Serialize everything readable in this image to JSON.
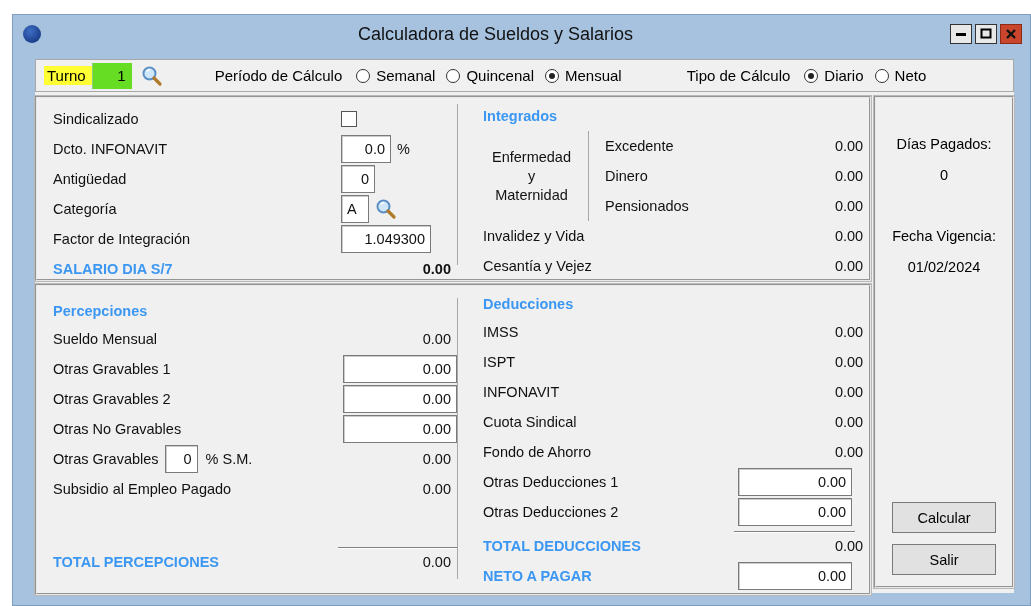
{
  "window": {
    "title": "Calculadora de Sueldos y Salarios"
  },
  "toolbar": {
    "turno": {
      "label": "Turno",
      "value": "1"
    },
    "periodo": {
      "label": "Período de Cálculo",
      "options": [
        {
          "label": "Semanal",
          "selected": false
        },
        {
          "label": "Quincenal",
          "selected": false
        },
        {
          "label": "Mensual",
          "selected": true
        }
      ]
    },
    "tipo": {
      "label": "Tipo de Cálculo",
      "options": [
        {
          "label": "Diario",
          "selected": true
        },
        {
          "label": "Neto",
          "selected": false
        }
      ]
    }
  },
  "general": {
    "rows": [
      {
        "kind": "checkbox",
        "label": "Sindicalizado",
        "checked": false
      },
      {
        "kind": "field",
        "label": "Dcto. INFONAVIT",
        "value": "0.0",
        "unit": "%"
      },
      {
        "kind": "field",
        "label": "Antigüedad",
        "value": "0"
      },
      {
        "kind": "lookup",
        "label": "Categoría",
        "value": "A"
      },
      {
        "kind": "field",
        "label": "Factor de Integración",
        "value": "1.049300"
      }
    ],
    "salario_dia": {
      "label": "SALARIO DIA S/7",
      "value": "0.00"
    }
  },
  "integrados": {
    "title": "Integrados",
    "group": {
      "lines": [
        "Enfermedad",
        "y",
        "Maternidad"
      ],
      "items": [
        {
          "label": "Excedente",
          "value": "0.00"
        },
        {
          "label": "Dinero",
          "value": "0.00"
        },
        {
          "label": "Pensionados",
          "value": "0.00"
        }
      ]
    },
    "items": [
      {
        "label": "Invalidez y Vida",
        "value": "0.00"
      },
      {
        "label": "Cesantía y Vejez",
        "value": "0.00"
      }
    ]
  },
  "percepciones": {
    "title": "Percepciones",
    "rows": [
      {
        "kind": "value",
        "label": "Sueldo Mensual",
        "value": "0.00"
      },
      {
        "kind": "field",
        "label": "Otras Gravables 1",
        "value": "0.00"
      },
      {
        "kind": "field",
        "label": "Otras Gravables 2",
        "value": "0.00"
      },
      {
        "kind": "field",
        "label": "Otras No Gravables",
        "value": "0.00"
      },
      {
        "kind": "percent",
        "label": "Otras Gravables",
        "percent": "0",
        "unit": "% S.M.",
        "value": "0.00"
      },
      {
        "kind": "value",
        "label": "Subsidio al Empleo Pagado",
        "value": "0.00"
      }
    ],
    "total": {
      "label": "TOTAL PERCEPCIONES",
      "value": "0.00"
    }
  },
  "deducciones": {
    "title": "Deducciones",
    "rows": [
      {
        "kind": "value",
        "label": "IMSS",
        "value": "0.00"
      },
      {
        "kind": "value",
        "label": "ISPT",
        "value": "0.00"
      },
      {
        "kind": "value",
        "label": "INFONAVIT",
        "value": "0.00"
      },
      {
        "kind": "value",
        "label": "Cuota Sindical",
        "value": "0.00"
      },
      {
        "kind": "value",
        "label": "Fondo de Ahorro",
        "value": "0.00"
      },
      {
        "kind": "field",
        "label": "Otras Deducciones 1",
        "value": "0.00"
      },
      {
        "kind": "field",
        "label": "Otras Deducciones 2",
        "value": "0.00"
      }
    ],
    "total": {
      "label": "TOTAL DEDUCCIONES",
      "value": "0.00"
    },
    "neto": {
      "label": "NETO A PAGAR",
      "value": "0.00"
    }
  },
  "side": {
    "dias": {
      "label": "Días Pagados:",
      "value": "0"
    },
    "fecha": {
      "label": "Fecha Vigencia:",
      "value": "01/02/2024"
    },
    "buttons": [
      "Calcular",
      "Salir"
    ]
  }
}
